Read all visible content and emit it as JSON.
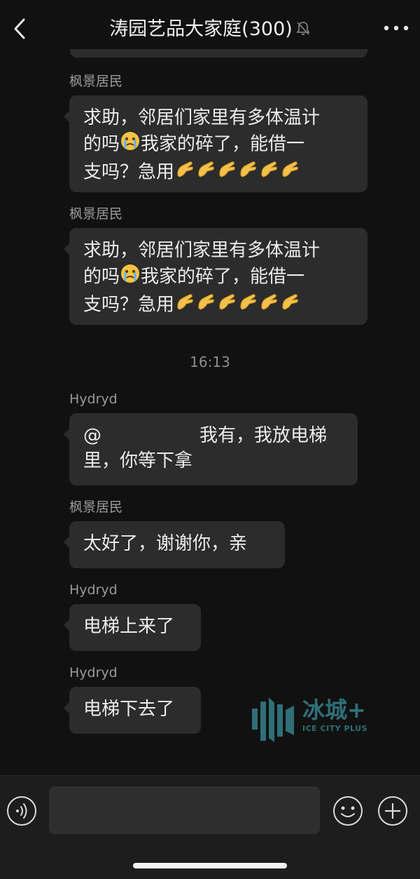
{
  "header": {
    "title": "涛园艺品大家庭(300)",
    "back_icon": "chevron-left-icon",
    "mute_icon": "bell-muted-icon",
    "more_icon": "more-dots-icon"
  },
  "messages": [
    {
      "sender": "枫景居民",
      "text_a": "求助，邻居们家里有多体温计",
      "text_b1": "的吗",
      "text_b2": "我家的碎了，能借一",
      "text_c": "支吗？急用",
      "emoji_cry": "crying-face-emoji",
      "emoji_hand": "pinching-hand-emoji"
    },
    {
      "sender": "枫景居民",
      "text_a": "求助，邻居们家里有多体温计",
      "text_b1": "的吗",
      "text_b2": "我家的碎了，能借一",
      "text_c": "支吗？急用",
      "emoji_cry": "crying-face-emoji",
      "emoji_hand": "pinching-hand-emoji"
    },
    {
      "sender": "Hydryd",
      "mention": "@",
      "text_a": "我有，我放电梯",
      "text_b": "里，你等下拿"
    },
    {
      "sender": "枫景居民",
      "text": "太好了，谢谢你，亲"
    },
    {
      "sender": "Hydryd",
      "text": "电梯上来了"
    },
    {
      "sender": "Hydryd",
      "text": "电梯下去了"
    }
  ],
  "timestamp": "16:13",
  "watermark": {
    "cn": "冰城+",
    "en": "ICE CITY PLUS"
  },
  "input_bar": {
    "voice_icon": "voice-icon",
    "emoji_icon": "smiley-icon",
    "plus_icon": "plus-circle-icon",
    "input_value": ""
  },
  "colors": {
    "background": "#111111",
    "bubble": "#2c2c2c",
    "input_bar": "#1d1d1d",
    "watermark": "#2f6f78"
  }
}
